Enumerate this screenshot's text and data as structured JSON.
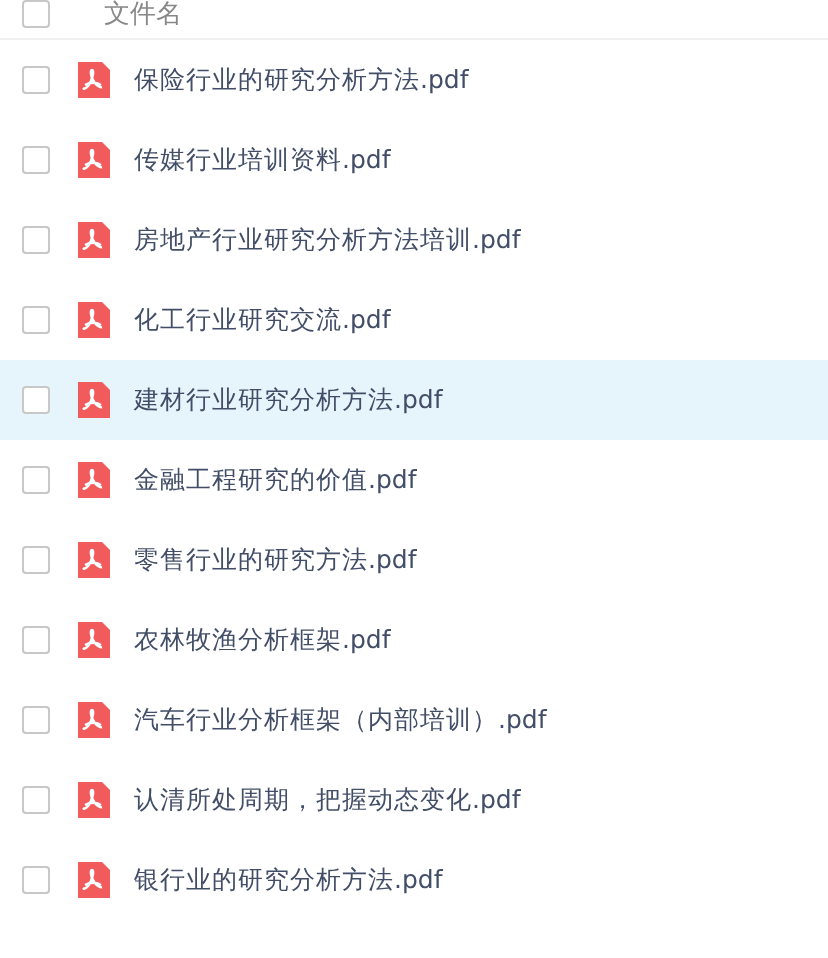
{
  "header": {
    "label": "文件名",
    "checked": false
  },
  "files": [
    {
      "name": "保险行业的研究分析方法.pdf",
      "checked": false,
      "selected": false
    },
    {
      "name": "传媒行业培训资料.pdf",
      "checked": false,
      "selected": false
    },
    {
      "name": "房地产行业研究分析方法培训.pdf",
      "checked": false,
      "selected": false
    },
    {
      "name": "化工行业研究交流.pdf",
      "checked": false,
      "selected": false
    },
    {
      "name": "建材行业研究分析方法.pdf",
      "checked": false,
      "selected": true
    },
    {
      "name": "金融工程研究的价值.pdf",
      "checked": false,
      "selected": false
    },
    {
      "name": "零售行业的研究方法.pdf",
      "checked": false,
      "selected": false
    },
    {
      "name": "农林牧渔分析框架.pdf",
      "checked": false,
      "selected": false
    },
    {
      "name": "汽车行业分析框架（内部培训）.pdf",
      "checked": false,
      "selected": false
    },
    {
      "name": "认清所处周期，把握动态变化.pdf",
      "checked": false,
      "selected": false
    },
    {
      "name": "银行业的研究分析方法.pdf",
      "checked": false,
      "selected": false
    }
  ]
}
